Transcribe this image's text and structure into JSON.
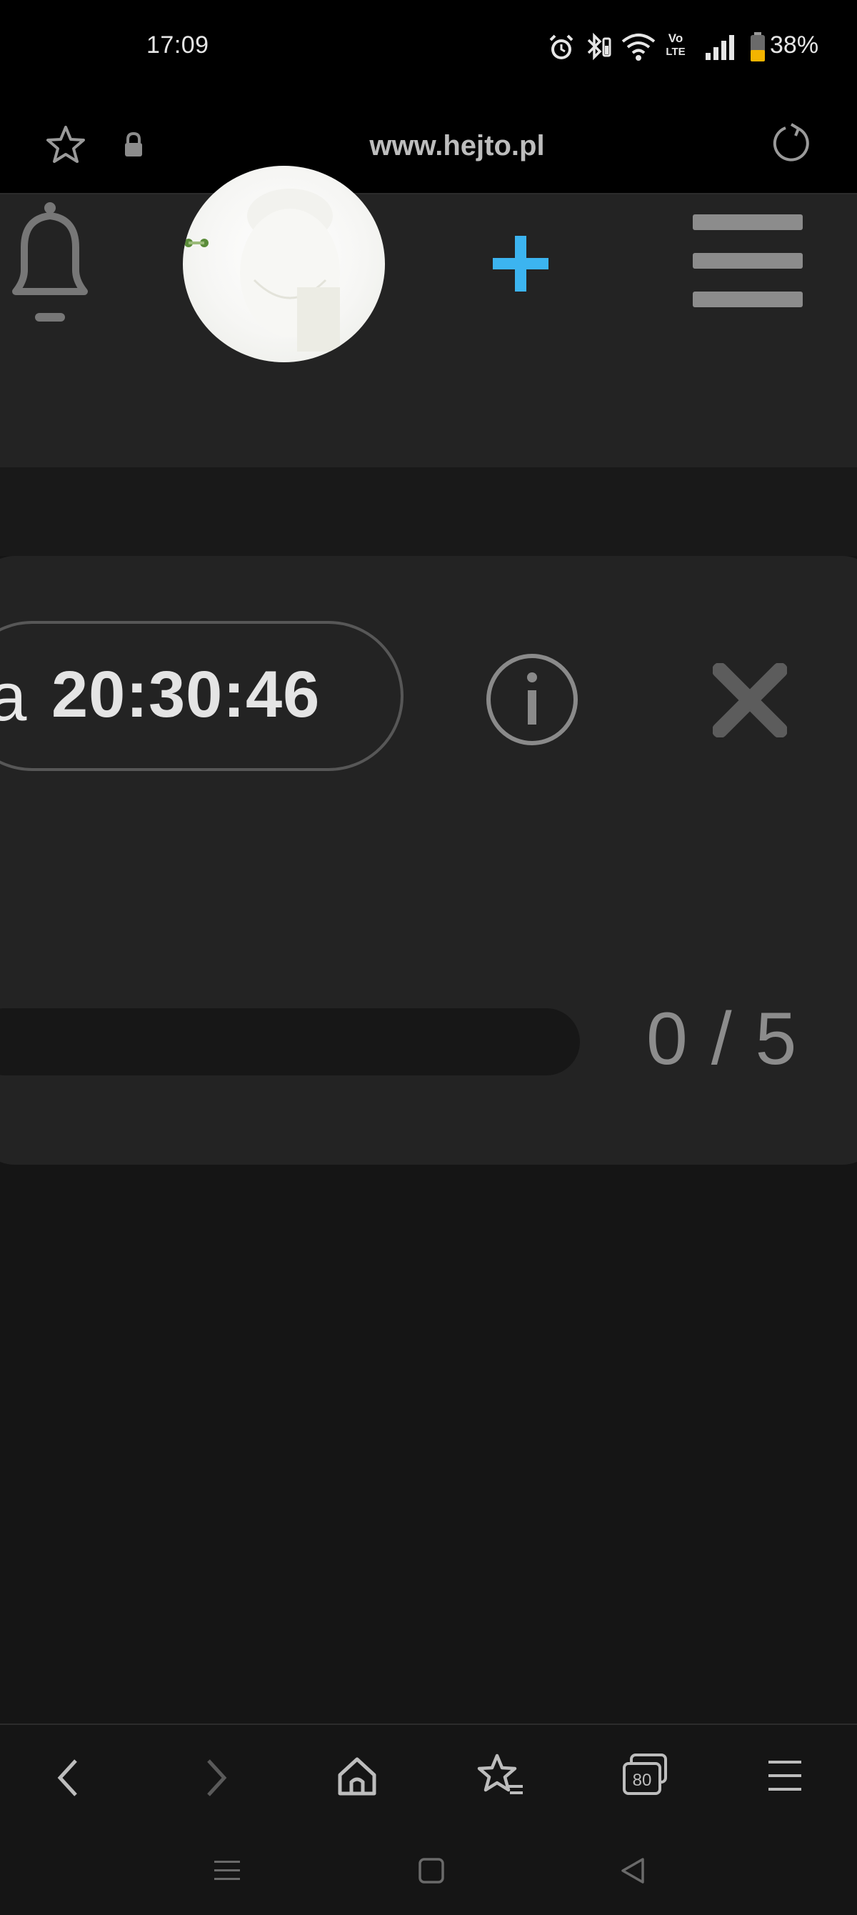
{
  "status_bar": {
    "time": "17:09",
    "battery_percent": "38%",
    "icons": [
      "alarm-icon",
      "bluetooth-icon",
      "wifi-icon",
      "volte-icon",
      "signal-icon",
      "battery-icon"
    ],
    "volte_label_top": "Vo",
    "volte_label_bottom": "LTE"
  },
  "url_bar": {
    "url": "www.hejto.pl",
    "icons": [
      "bookmark-star-icon",
      "lock-icon",
      "reload-icon"
    ]
  },
  "site_header": {
    "icons": [
      "bell-icon",
      "avatar",
      "add-icon",
      "menu-icon"
    ],
    "accent_color": "#3cb4f0"
  },
  "card": {
    "timer_prefix": "a",
    "timer": "20:30:46",
    "progress": {
      "current": 0,
      "max": 5,
      "display": "0 / 5"
    },
    "icons": [
      "info-icon",
      "close-icon"
    ]
  },
  "browser_toolbar": {
    "tab_count": "80",
    "icons": [
      "back-icon",
      "forward-icon",
      "home-icon",
      "bookmarks-icon",
      "tabs-icon",
      "menu-icon"
    ]
  },
  "system_nav": {
    "icons": [
      "recents-icon",
      "home-button-icon",
      "back-triangle-icon"
    ]
  }
}
